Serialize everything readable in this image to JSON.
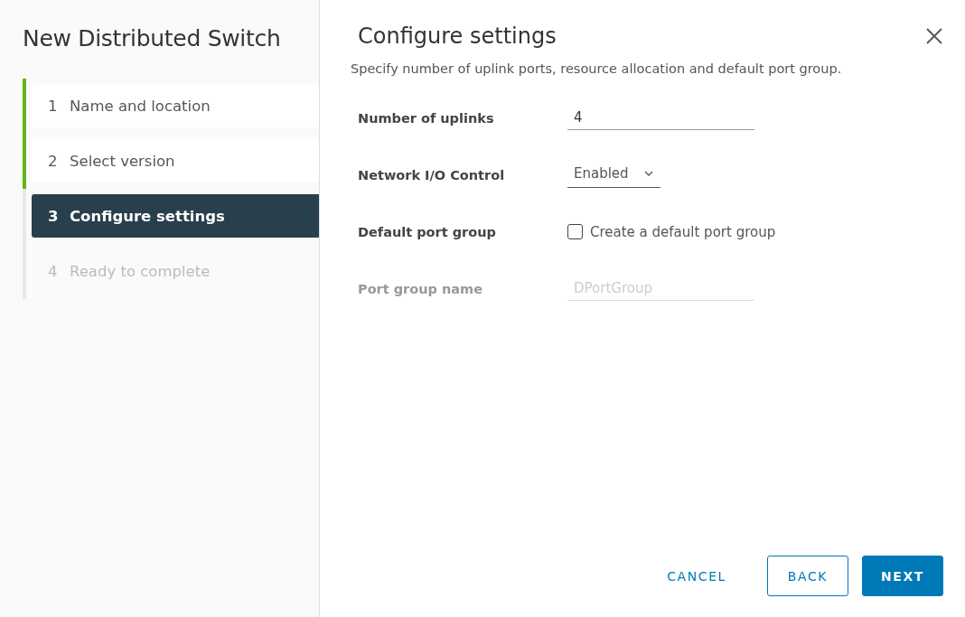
{
  "wizard": {
    "title": "New Distributed Switch",
    "steps": [
      {
        "number": "1",
        "label": "Name and location",
        "completed": true,
        "selected": false,
        "disabled": false
      },
      {
        "number": "2",
        "label": "Select version",
        "completed": true,
        "selected": false,
        "disabled": false
      },
      {
        "number": "3",
        "label": "Configure settings",
        "completed": false,
        "selected": true,
        "disabled": false
      },
      {
        "number": "4",
        "label": "Ready to complete",
        "completed": false,
        "selected": false,
        "disabled": true
      }
    ]
  },
  "page": {
    "title": "Configure settings",
    "subtitle": "Specify number of uplink ports, resource allocation and default port group.",
    "fields": [
      {
        "kind": "text",
        "label": "Number of uplinks",
        "value": "4",
        "disabled": false
      },
      {
        "kind": "select",
        "label": "Network I/O Control",
        "value": "Enabled",
        "disabled": false
      },
      {
        "kind": "checkbox",
        "label": "Default port group",
        "option": "Create a default port group",
        "checked": false,
        "disabled": false
      },
      {
        "kind": "text",
        "label": "Port group name",
        "placeholder": "DPortGroup",
        "disabled": true
      }
    ]
  },
  "buttons": [
    {
      "kind": "link",
      "label": "CANCEL"
    },
    {
      "kind": "outline",
      "label": "BACK"
    },
    {
      "kind": "primary",
      "label": "NEXT"
    }
  ]
}
